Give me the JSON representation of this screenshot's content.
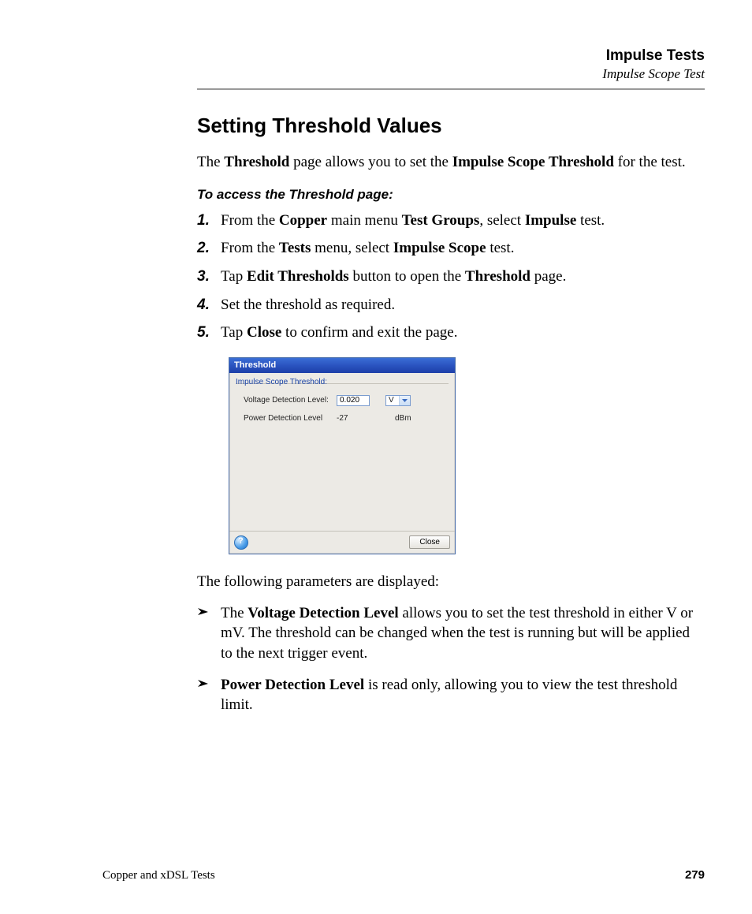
{
  "header": {
    "title": "Impulse Tests",
    "subtitle": "Impulse Scope Test"
  },
  "section_title": "Setting Threshold Values",
  "intro": {
    "pre": "The ",
    "b1": "Threshold",
    "mid": " page allows you to set the ",
    "b2": "Impulse Scope Threshold",
    "post": " for the test."
  },
  "access_heading": "To access the Threshold page:",
  "steps": [
    {
      "num": "1.",
      "pre": "From the ",
      "b1": "Copper",
      "mid": " main menu ",
      "b2": "Test Groups",
      "mid2": ", select ",
      "b3": "Impulse",
      "post": " test."
    },
    {
      "num": "2.",
      "pre": "From the ",
      "b1": "Tests",
      "mid": " menu, select ",
      "b2": "Impulse Scope",
      "post": " test."
    },
    {
      "num": "3.",
      "pre": "Tap ",
      "b1": "Edit Thresholds",
      "mid": " button to open the ",
      "b2": "Threshold",
      "post": " page."
    },
    {
      "num": "4.",
      "plain": "Set the threshold as required."
    },
    {
      "num": "5.",
      "pre": "Tap ",
      "b1": "Close",
      "post": " to confirm and exit the page."
    }
  ],
  "dialog": {
    "title": "Threshold",
    "group": "Impulse Scope Threshold:",
    "voltage_label": "Voltage Detection Level:",
    "voltage_value": "0.020",
    "voltage_unit": "V",
    "power_label": "Power Detection Level",
    "power_value": "-27",
    "power_unit": "dBm",
    "close": "Close"
  },
  "following": "The following parameters are displayed:",
  "bullets": [
    {
      "pre": "The ",
      "b": "Voltage Detection Level",
      "post": " allows you to set the test threshold in either V or mV. The threshold can be changed when the test is running but will be applied to the next trigger event."
    },
    {
      "b": "Power Detection Level",
      "post": " is read only, allowing you to view the test threshold limit."
    }
  ],
  "footer": {
    "left": "Copper and xDSL Tests",
    "page": "279"
  }
}
